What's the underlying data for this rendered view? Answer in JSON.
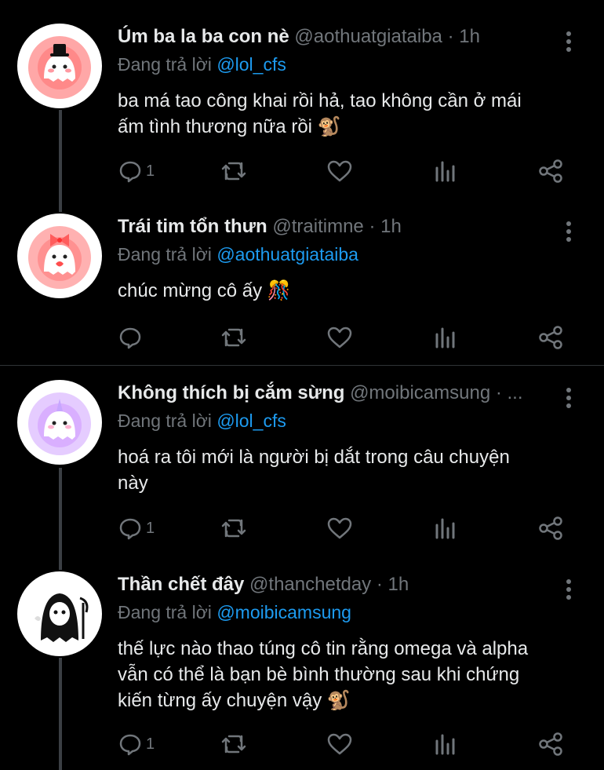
{
  "tweets": [
    {
      "name": "Úm ba la ba con nè",
      "handle": "@aothuatgiataiba",
      "time": "· 1h",
      "reply_prefix": "Đang trả lời",
      "reply_to": "@lol_cfs",
      "text_lines": [
        "ba má tao công khai rồi hả, tao không cần ở mái",
        "ấm tình thương nữa rồi"
      ],
      "emoji": "🐒",
      "reply_count": "1",
      "avatar_icon": "ghost-hat-avatar",
      "avatar_color": "#ff4d4d"
    },
    {
      "name": "Trái tim tổn thưn",
      "handle": "@traitimne",
      "time": "· 1h",
      "reply_prefix": "Đang trả lời",
      "reply_to": "@aothuatgiataiba",
      "text_lines": [
        "chúc mừng cô ấy"
      ],
      "emoji": "🎊",
      "reply_count": "",
      "avatar_icon": "ghost-bow-avatar",
      "avatar_color": "#ff4d4d"
    },
    {
      "name": "Không thích bị cắm sừng",
      "handle": "@moibicamsung · ...",
      "time": "",
      "reply_prefix": "Đang trả lời",
      "reply_to": "@lol_cfs",
      "text_lines": [
        "hoá ra tôi mới là người bị dắt trong câu chuyện",
        "này"
      ],
      "emoji": "",
      "reply_count": "1",
      "avatar_icon": "ghost-unicorn-avatar",
      "avatar_color": "#b56cff"
    },
    {
      "name": "Thần chết đây",
      "handle": "@thanchetday",
      "time": "· 1h",
      "reply_prefix": "Đang trả lời",
      "reply_to": "@moibicamsung",
      "text_lines": [
        "thế lực nào thao túng cô tin rằng omega và alpha",
        "vẫn có thể là bạn bè bình thường sau khi chứng",
        "kiến từng ấy chuyện vậy"
      ],
      "emoji": "🐒",
      "reply_count": "1",
      "avatar_icon": "grim-reaper-avatar",
      "avatar_color": "#111111"
    }
  ],
  "colors": {
    "background": "#000000",
    "text": "#e7e9ea",
    "muted": "#71767b",
    "link": "#1d9bf0"
  }
}
